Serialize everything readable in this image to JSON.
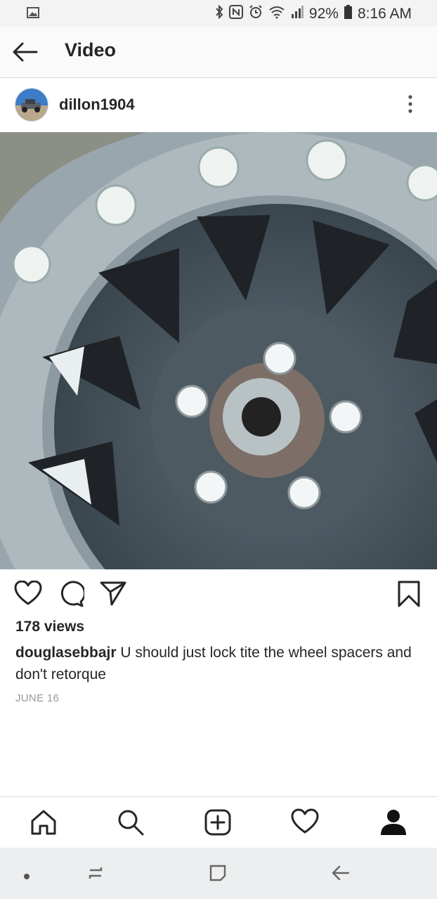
{
  "status_bar": {
    "battery": "92%",
    "time": "8:16 AM"
  },
  "header": {
    "title": "Video"
  },
  "post": {
    "username": "dillon1904",
    "views": "178 views",
    "comment_user": "douglasebbajr",
    "comment_text": " U should just lock tite the wheel spacers and don't retorque",
    "date": "JUNE 16"
  },
  "icons": {
    "header": [
      "back-arrow-icon"
    ],
    "post": [
      "more-options-icon"
    ],
    "actions": [
      "heart-icon",
      "comment-icon",
      "share-icon",
      "bookmark-icon"
    ],
    "bottom_nav": [
      "home-icon",
      "search-icon",
      "add-post-icon",
      "activity-heart-icon",
      "profile-icon"
    ],
    "system_nav": [
      "dot-icon",
      "recents-icon",
      "home-square-icon",
      "back-icon"
    ]
  },
  "colors": {
    "text": "#262626",
    "muted": "#999999",
    "divider": "#dbdbdb"
  }
}
